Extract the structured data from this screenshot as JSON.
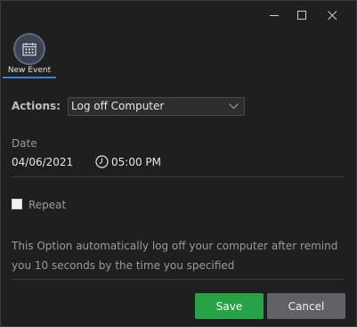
{
  "window": {
    "controls": [
      "minimize-icon",
      "maximize-icon",
      "close-icon"
    ]
  },
  "event_tab": {
    "label": "New Event",
    "icon": "calendar-icon",
    "accent_color": "#3b82d6"
  },
  "form": {
    "actions_label": "Actions:",
    "action_selected": "Log off Computer",
    "date_label": "Date",
    "date_value": "04/06/2021",
    "time_value": "05:00 PM",
    "repeat_label": "Repeat",
    "repeat_checked": false,
    "description": "This Option automatically log off your computer after remind you 10 seconds by the time you specified"
  },
  "buttons": {
    "save_label": "Save",
    "save_color": "#27a345",
    "cancel_label": "Cancel",
    "cancel_color": "#5f6368"
  }
}
